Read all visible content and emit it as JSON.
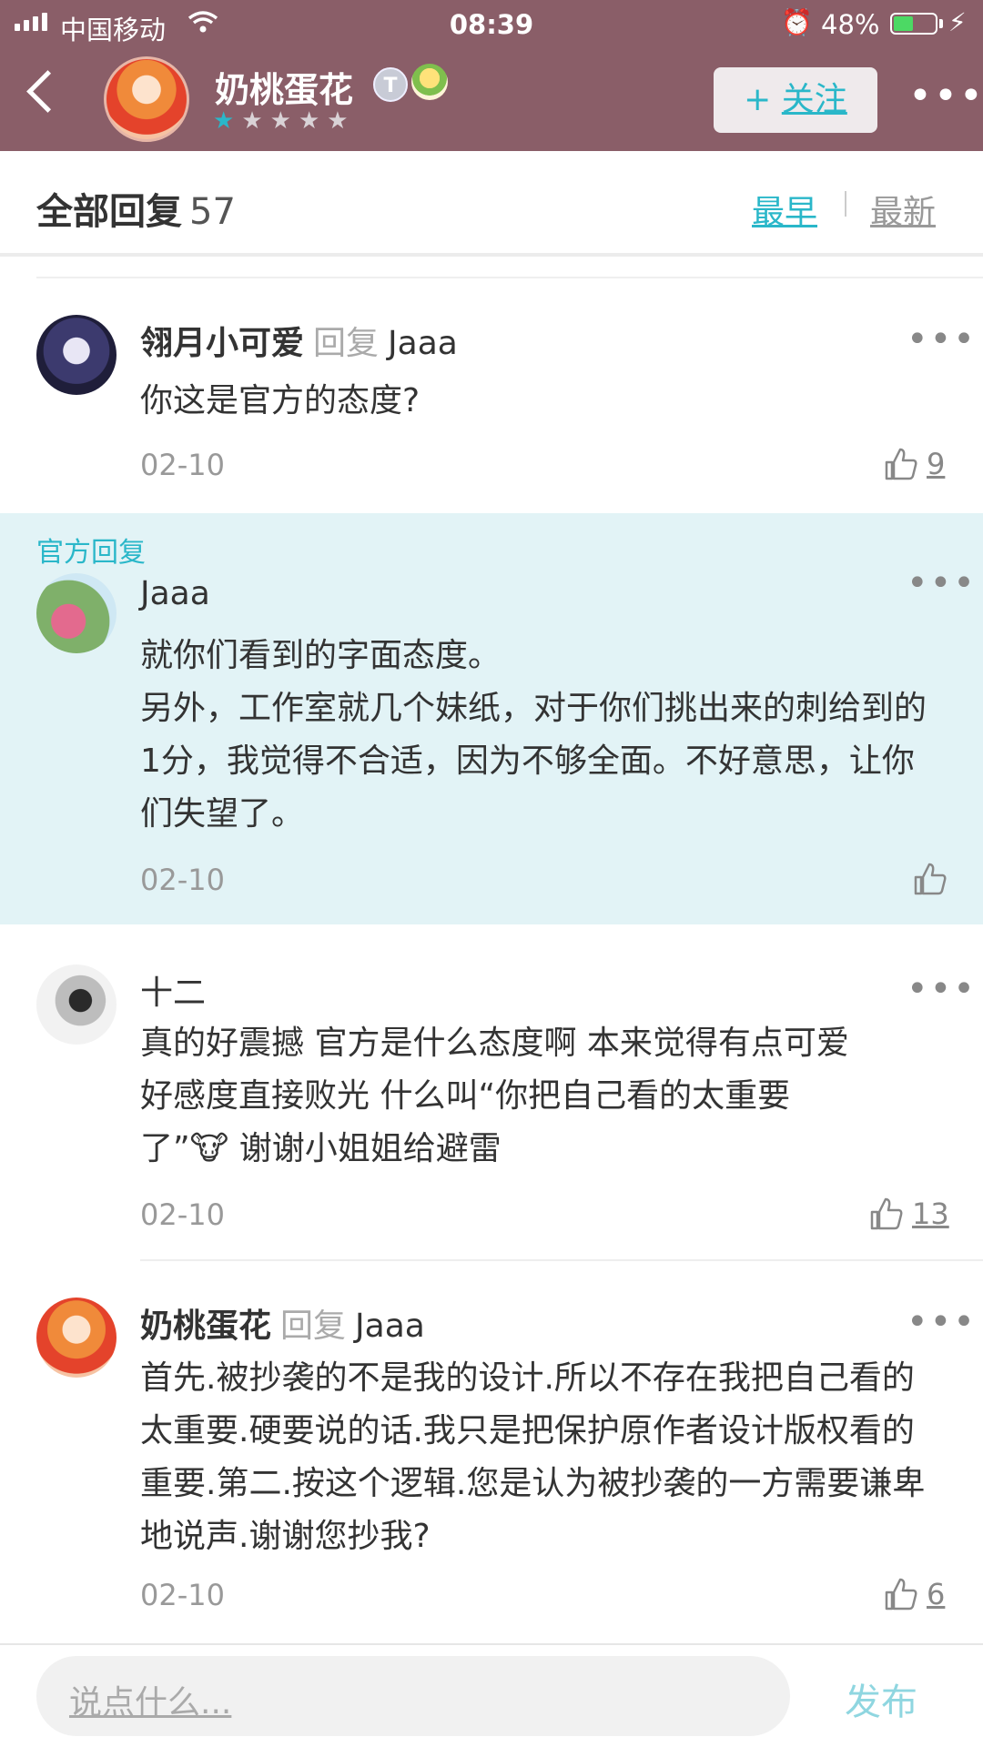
{
  "status_bar": {
    "carrier": "中国移动",
    "time": "08:39",
    "battery": "48%",
    "battery_level": 0.48
  },
  "profile": {
    "name": "奶桃蛋花",
    "level_badge": "T",
    "rating": 1,
    "rating_max": 5,
    "follow_label": "关注",
    "follow_plus": "+"
  },
  "replies_header": {
    "title": "全部回复",
    "count": "57",
    "sort_earliest": "最早",
    "sort_latest": "最新"
  },
  "colors": {
    "topbar": "#8a5e68",
    "accent": "#2ab7c9",
    "official_bg": "#e2f3f6"
  },
  "comments": [
    {
      "author": "翎月小可爱",
      "reply_word": "回复",
      "reply_to": "Jaaa",
      "text": "你这是官方的态度?",
      "date": "02-10",
      "likes": "9"
    },
    {
      "official_label": "官方回复",
      "author": "Jaaa",
      "text": "就你们看到的字面态度。\n另外，工作室就几个妹纸，对于你们挑出来的刺给到的1分，我觉得不合适，因为不够全面。不好意思，让你们失望了。",
      "date": "02-10",
      "likes": ""
    },
    {
      "author": "十二",
      "text": "真的好震撼 官方是什么态度啊 本来觉得有点可爱\n好感度直接败光 什么叫“你把自己看的太重要\n了”🐮 谢谢小姐姐给避雷",
      "date": "02-10",
      "likes": "13"
    },
    {
      "author": "奶桃蛋花",
      "reply_word": "回复",
      "reply_to": "Jaaa",
      "text": "首先.被抄袭的不是我的设计.所以不存在我把自己看的太重要.硬要说的话.我只是把保护原作者设计版权看的重要.第二.按这个逻辑.您是认为被抄袭的一方需要谦卑地说声.谢谢您抄我?",
      "date": "02-10",
      "likes": "6"
    }
  ],
  "composer": {
    "placeholder": "说点什么...",
    "publish_label": "发布"
  }
}
